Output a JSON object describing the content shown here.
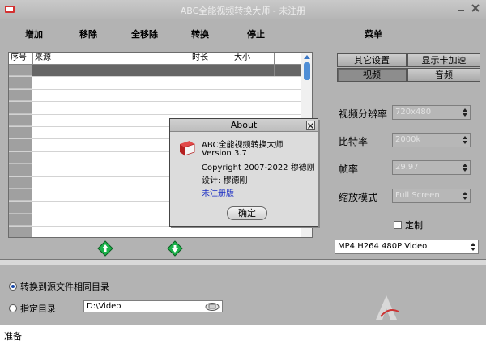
{
  "window": {
    "title": "ABC全能视频转换大师 - 未注册"
  },
  "toolbar": {
    "add": "增加",
    "remove": "移除",
    "remove_all": "全移除",
    "convert": "转换",
    "stop": "停止",
    "menu": "菜单"
  },
  "table": {
    "columns": [
      "序号",
      "来源",
      "时长",
      "大小"
    ]
  },
  "tabs": {
    "other_settings": "其它设置",
    "display_accel": "显示卡加速",
    "video": "视频",
    "audio": "音频"
  },
  "video_settings": {
    "resolution_label": "视频分辨率",
    "resolution_value": "720x480",
    "bitrate_label": "比特率",
    "bitrate_value": "2000k",
    "framerate_label": "帧率",
    "framerate_value": "29.97",
    "scale_label": "缩放模式",
    "scale_value": "Full Screen",
    "custom_label": "定制"
  },
  "format": {
    "value": "MP4 H264 480P Video"
  },
  "output": {
    "same_dir_label": "转换到源文件相同目录",
    "custom_dir_label": "指定目录",
    "dir_value": "D:\\Video"
  },
  "status": {
    "text": "准备"
  },
  "about": {
    "title": "About",
    "app_name": "ABC全能视频转换大师",
    "version": "Version 3.7",
    "copyright": "Copyright 2007-2022 穆德刚",
    "designer": "设计: 穆德刚",
    "unregistered": "未注册版",
    "ok": "确定"
  },
  "colors": {
    "window_bg": "#b3b3b3",
    "selected_row": "#666666",
    "link": "#1b2ec4",
    "arrow_green": "#1bb24a"
  }
}
